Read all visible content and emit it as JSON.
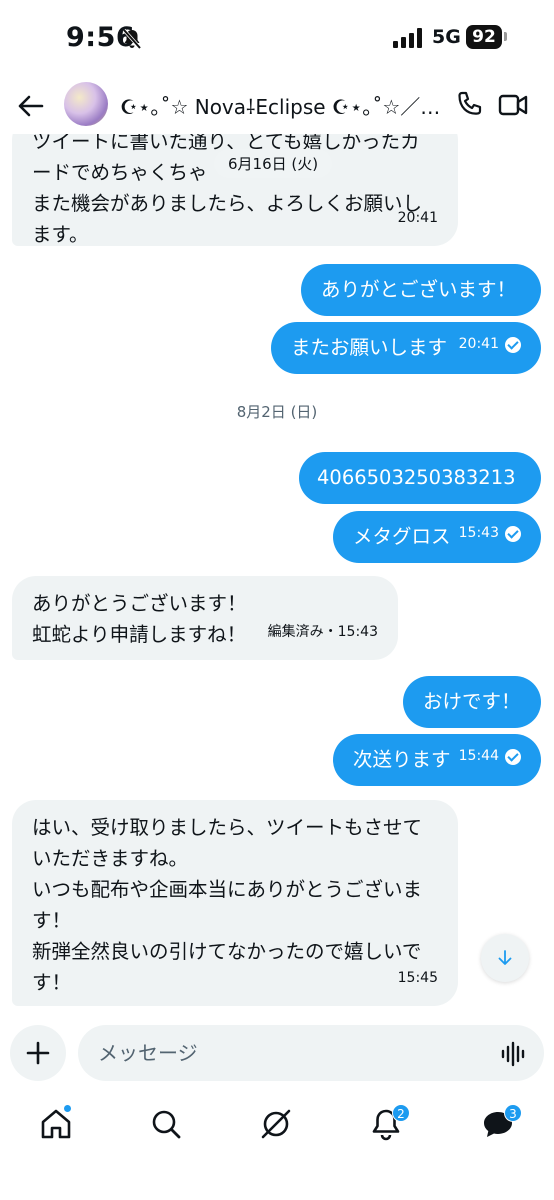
{
  "status": {
    "time": "9:56",
    "network": "5G",
    "battery": "92"
  },
  "header": {
    "title": "☪︎⋆｡˚☆ Nova⸸Eclipse ☪︎⋆｡˚☆／…"
  },
  "floating_date": "6月16日 (火)",
  "messages": [
    {
      "dir": "in",
      "lines": [
        "ツイートに書いた通り、とても嬉しかったカ",
        "ードでめちゃくちゃ",
        "また機会がありましたら、よろしくお願いし",
        "ます。"
      ],
      "time": "20:41"
    },
    {
      "dir": "out",
      "text": "ありがとございます！"
    },
    {
      "dir": "out",
      "text": "またお願いします",
      "time": "20:41"
    },
    {
      "dir": "sep",
      "text": "8月2日 (日)"
    },
    {
      "dir": "out",
      "text": "4066503250383213"
    },
    {
      "dir": "out",
      "text": "メタグロス",
      "time": "15:43"
    },
    {
      "dir": "in",
      "lines": [
        "ありがとうございます！",
        "虹蛇より申請しますね！"
      ],
      "time": "編集済み・15:43"
    },
    {
      "dir": "out",
      "text": "おけです！"
    },
    {
      "dir": "out",
      "text": "次送ります",
      "time": "15:44"
    },
    {
      "dir": "in",
      "lines": [
        "はい、受け取りましたら、ツイートもさせて",
        "いただきますね。",
        "いつも配布や企画本当にありがとうございま",
        "す！",
        "新弾全然良いの引けてなかったので嬉しいで",
        "す！"
      ],
      "time": "15:45"
    }
  ],
  "composer": {
    "placeholder": "メッセージ"
  },
  "nav": {
    "notifications_badge": "2",
    "messages_badge": "3"
  },
  "colors": {
    "accent": "#1d9bf0",
    "incoming_bg": "#eff3f4"
  }
}
